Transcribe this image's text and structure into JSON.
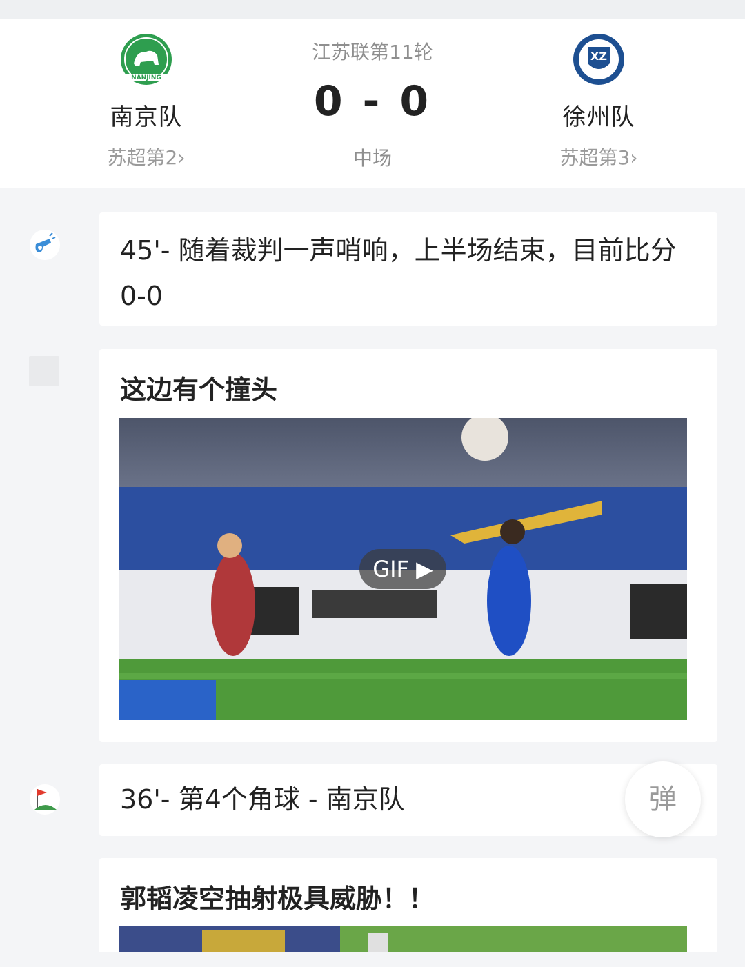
{
  "match": {
    "league_round": "江苏联第11轮",
    "score": "0 - 0",
    "status": "中场",
    "home": {
      "name": "南京队",
      "rank": "苏超第2",
      "logo_text": "NANJING"
    },
    "away": {
      "name": "徐州队",
      "rank": "苏超第3",
      "logo_text": "XZ"
    }
  },
  "timeline": [
    {
      "type": "whistle",
      "icon": "whistle-icon",
      "text": "45'- 随着裁判一声哨响，上半场结束，目前比分0-0"
    },
    {
      "type": "post",
      "icon": "placeholder-icon",
      "title": "这边有个撞头",
      "media_badge": "GIF"
    },
    {
      "type": "corner",
      "icon": "corner-flag-icon",
      "text": "36'- 第4个角球 - 南京队"
    },
    {
      "type": "post",
      "title": "郭韬凌空抽射极具威胁！！"
    }
  ],
  "float_button": {
    "label": "弹"
  },
  "colors": {
    "home_logo": "#2e9e4f",
    "away_logo": "#1d4f91",
    "accent_icon": "#3b8ed8",
    "corner_flag": "#e23b2e"
  }
}
